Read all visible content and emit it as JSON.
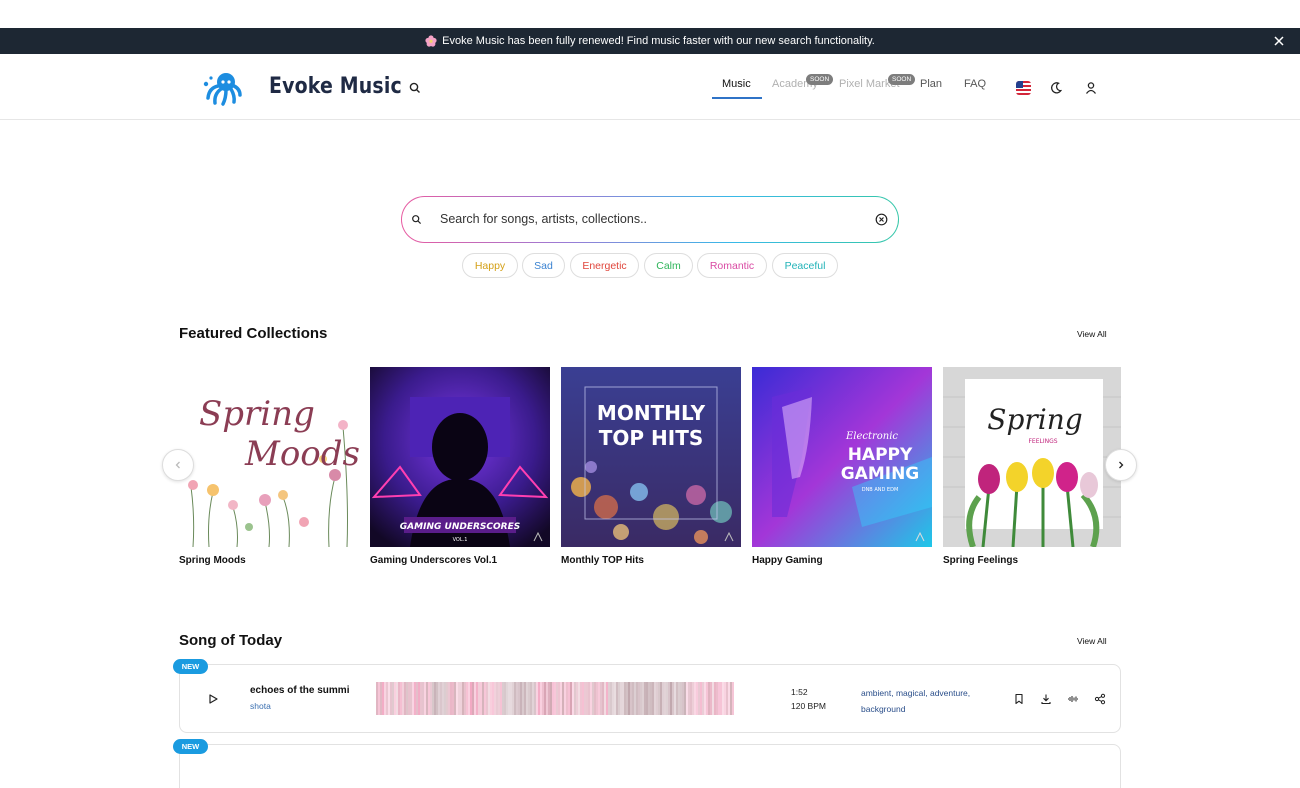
{
  "announcement": {
    "text": "Evoke Music has been fully renewed! Find music faster with our new search functionality."
  },
  "header": {
    "brand": "Evoke Music",
    "nav": [
      {
        "label": "Music",
        "active": true
      },
      {
        "label": "Academy",
        "badge": "SOON"
      },
      {
        "label": "Pixel Market",
        "badge": "SOON"
      },
      {
        "label": "Plan"
      },
      {
        "label": "FAQ"
      }
    ],
    "active_color": "#2f73c7"
  },
  "search": {
    "placeholder": "Search for songs, artists, collections.."
  },
  "moods": [
    {
      "label": "Happy",
      "color": "#d4a017"
    },
    {
      "label": "Sad",
      "color": "#3b83d1"
    },
    {
      "label": "Energetic",
      "color": "#e0463c"
    },
    {
      "label": "Calm",
      "color": "#2fb55a"
    },
    {
      "label": "Romantic",
      "color": "#d94aa3"
    },
    {
      "label": "Peaceful",
      "color": "#22b3b8"
    }
  ],
  "featured": {
    "title": "Featured Collections",
    "view_all": "View All",
    "collections": [
      {
        "title": "Spring Moods",
        "cover_text": [
          "Spring",
          "Moods"
        ]
      },
      {
        "title": "Gaming Underscores Vol.1",
        "cover_text": [
          "GAMING UNDERSCORES",
          "VOL.1"
        ]
      },
      {
        "title": "Monthly TOP Hits",
        "cover_text": [
          "MONTHLY",
          "TOP HITS"
        ]
      },
      {
        "title": "Happy Gaming",
        "cover_text": [
          "Electronic",
          "HAPPY",
          "GAMING",
          "DNB AND EDM"
        ]
      },
      {
        "title": "Spring Feelings",
        "cover_text": [
          "Spring",
          "FEELINGS"
        ]
      }
    ]
  },
  "song_of_today": {
    "title": "Song of Today",
    "view_all": "View All",
    "songs": [
      {
        "badge": "NEW",
        "name": "echoes of the summi",
        "artist": "shota",
        "duration": "1:52",
        "bpm": "120 BPM",
        "tags": "ambient, magical, adventure, background"
      },
      {
        "badge": "NEW"
      }
    ]
  }
}
